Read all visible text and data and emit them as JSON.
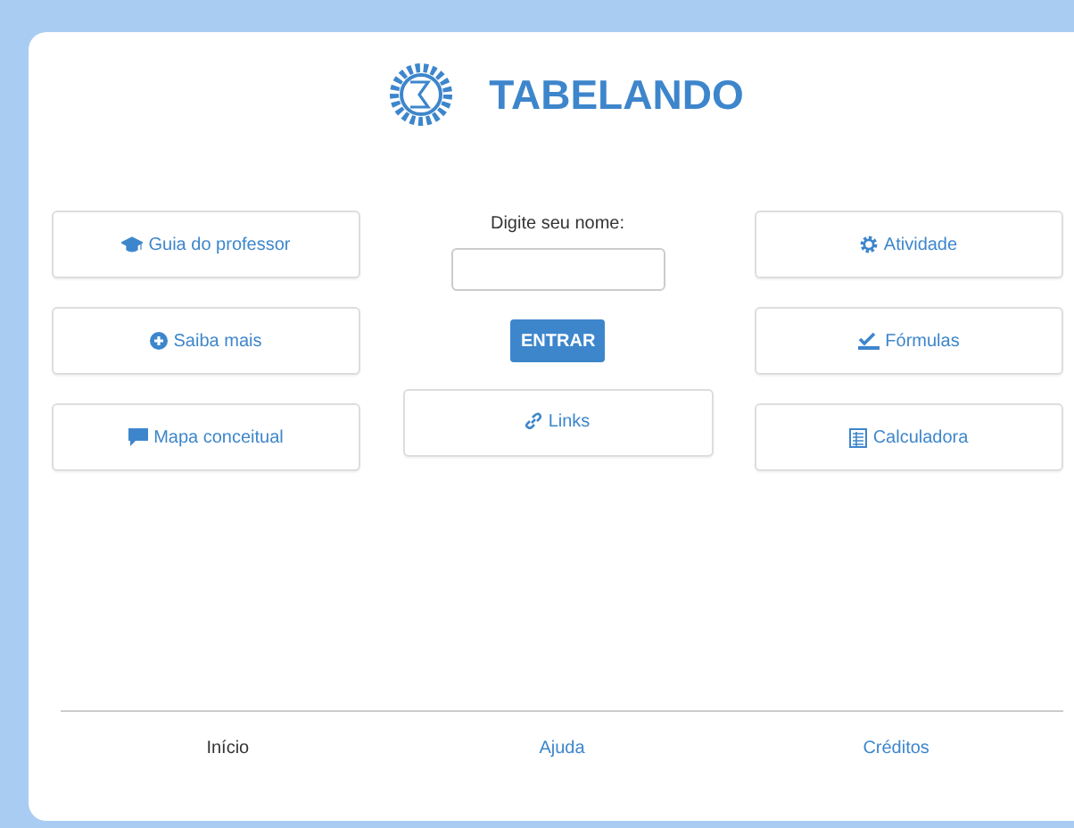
{
  "header": {
    "title": "TABELANDO"
  },
  "left_buttons": [
    {
      "label": "Guia do professor"
    },
    {
      "label": "Saiba mais"
    },
    {
      "label": "Mapa conceitual"
    }
  ],
  "login": {
    "label": "Digite seu nome:",
    "button": "ENTRAR"
  },
  "center_buttons": [
    {
      "label": "Links"
    }
  ],
  "right_buttons": [
    {
      "label": "Atividade"
    },
    {
      "label": "Fórmulas"
    },
    {
      "label": "Calculadora"
    }
  ],
  "footer_nav": [
    {
      "label": "Início",
      "selected": true
    },
    {
      "label": "Ajuda",
      "selected": false
    },
    {
      "label": "Créditos",
      "selected": false
    }
  ]
}
